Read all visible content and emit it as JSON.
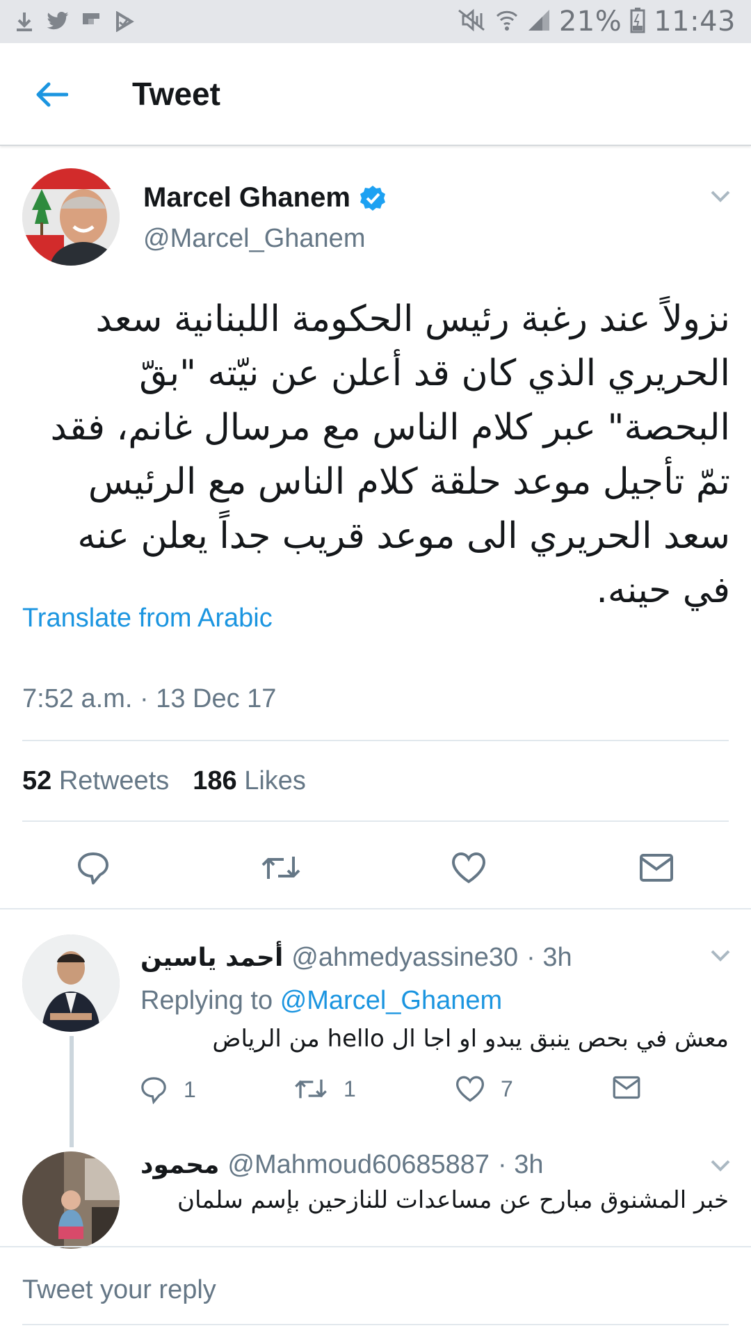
{
  "status_bar": {
    "battery": "21%",
    "time": "11:43",
    "icons": [
      "download-icon",
      "twitter-icon",
      "flipboard-icon",
      "play-icon",
      "mute-icon",
      "wifi-icon",
      "signal-icon",
      "battery-icon"
    ]
  },
  "header": {
    "title": "Tweet"
  },
  "tweet": {
    "author_name": "Marcel Ghanem",
    "author_handle": "@Marcel_Ghanem",
    "text": "نزولاً عند رغبة رئيس الحكومة اللبنانية سعد الحريري الذي كان قد أعلن عن نيّته \"بقّ البحصة\" عبر كلام الناس مع مرسال غانم، فقد تمّ تأجيل موعد حلقة كلام الناس مع الرئيس سعد الحريري الى موعد قريب جداً يعلن عنه في حينه.",
    "translate_label": "Translate from Arabic",
    "timestamp": "7:52 a.m. · 13 Dec 17",
    "retweets_count": "52",
    "retweets_label": "Retweets",
    "likes_count": "186",
    "likes_label": "Likes"
  },
  "replies": [
    {
      "name": "أحمد ياسين",
      "handle": "@ahmedyassine30",
      "time": "· 3h",
      "replying_prefix": "Replying to",
      "replying_to": "@Marcel_Ghanem",
      "text": "معش في بحص ينبق يبدو او اجا ال hello من الرياض",
      "reply_count": "1",
      "retweet_count": "1",
      "like_count": "7"
    },
    {
      "name": "محمود",
      "handle": "@Mahmoud60685887",
      "time": "· 3h",
      "text": "خبر المشنوق مبارح  عن مساعدات للنازحين بإسم سلمان"
    }
  ],
  "compose": {
    "placeholder": "Tweet your reply"
  },
  "colors": {
    "accent": "#1b95e0",
    "text": "#14171a",
    "secondary": "#657786"
  }
}
